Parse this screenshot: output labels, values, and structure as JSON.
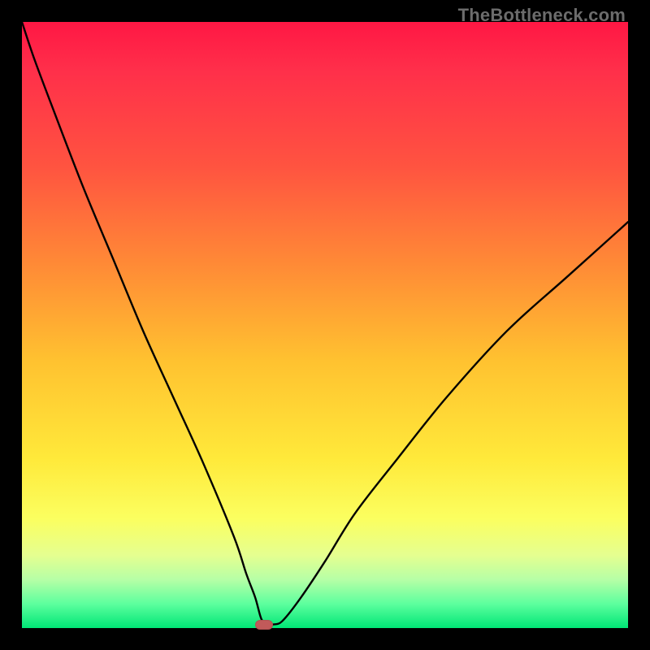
{
  "watermark": "TheBottleneck.com",
  "colors": {
    "frame_bg": "#000000",
    "gradient_top": "#ff1744",
    "gradient_mid": "#ffe93a",
    "gradient_bottom": "#00e676",
    "curve": "#000000",
    "marker": "#c15a5a"
  },
  "chart_data": {
    "type": "line",
    "title": "",
    "xlabel": "",
    "ylabel": "",
    "xlim": [
      0,
      100
    ],
    "ylim": [
      0,
      100
    ],
    "grid": false,
    "legend": false,
    "series": [
      {
        "name": "curve",
        "x": [
          0,
          2,
          5,
          10,
          15,
          20,
          25,
          30,
          35,
          37,
          38.5,
          39.5,
          40.5,
          41.5,
          43,
          46,
          50,
          55,
          62,
          70,
          80,
          90,
          100
        ],
        "y": [
          100,
          94,
          86,
          73,
          61,
          49,
          38,
          27,
          15,
          9,
          5,
          1.5,
          0.6,
          0.6,
          1.2,
          5,
          11,
          19,
          28,
          38,
          49,
          58,
          67
        ]
      }
    ],
    "marker": {
      "x": 40,
      "y": 0.6
    }
  }
}
